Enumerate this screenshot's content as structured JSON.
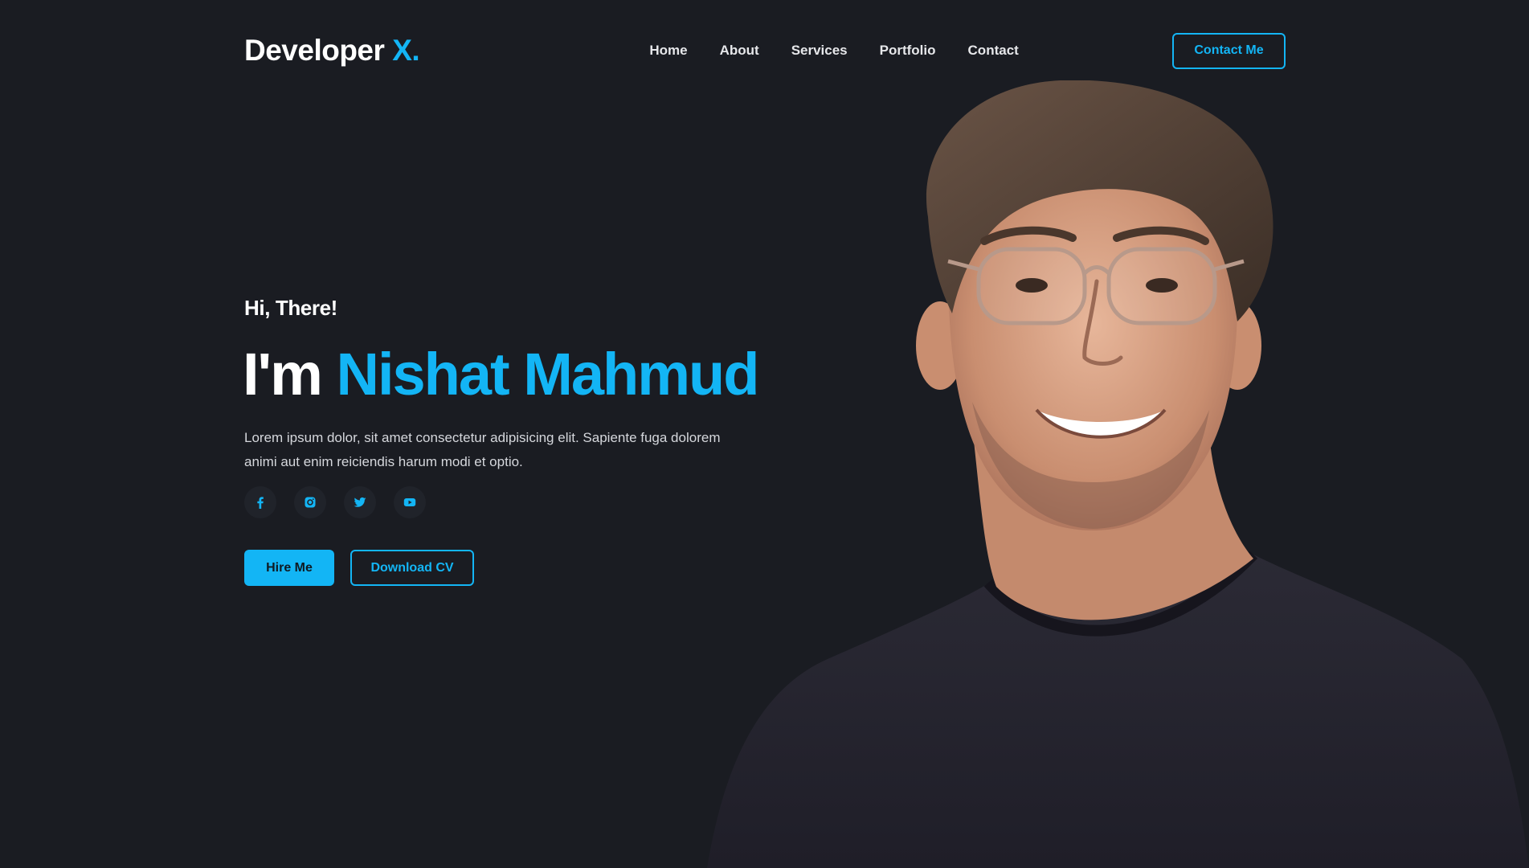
{
  "brand": {
    "name": "Developer",
    "accent": "X."
  },
  "nav": {
    "links": [
      "Home",
      "About",
      "Services",
      "Portfolio",
      "Contact"
    ],
    "cta_label": "Contact Me"
  },
  "hero": {
    "greeting": "Hi, There!",
    "headline_prefix": "I'm",
    "headline_name": "Nishat Mahmud",
    "intro_line1": "Lorem ipsum dolor, sit amet consectetur adipisicing elit. Sapiente fuga dolorem",
    "intro_line2": "animi aut enim reiciendis harum modi et optio.",
    "social_icons": [
      "facebook-icon",
      "instagram-icon",
      "twitter-icon",
      "youtube-icon"
    ],
    "primary_button": "Hire Me",
    "secondary_button": "Download CV"
  },
  "colors": {
    "background": "#1a1c22",
    "accent": "#13b5f5",
    "text": "#ffffff",
    "muted_text": "#d5d7dc",
    "social_bg": "#20232a"
  }
}
